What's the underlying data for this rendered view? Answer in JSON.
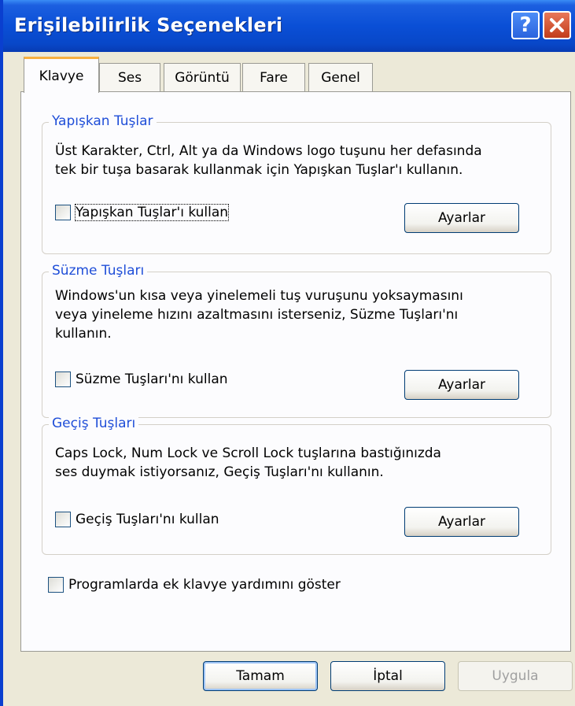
{
  "window": {
    "title": "Erişilebilirlik Seçenekleri"
  },
  "titlebar_buttons": {
    "help_label": "?",
    "help_icon": "help-icon",
    "close_icon": "close-icon"
  },
  "tabs": [
    {
      "label": "Klavye",
      "active": true
    },
    {
      "label": "Ses"
    },
    {
      "label": "Görüntü"
    },
    {
      "label": "Fare"
    },
    {
      "label": "Genel"
    }
  ],
  "groups": {
    "sticky": {
      "legend": "Yapışkan Tuşlar",
      "desc_line1": "Üst Karakter, Ctrl, Alt ya da Windows logo tuşunu her defasında",
      "desc_line2": "tek bir tuşa basarak kullanmak için Yapışkan Tuşlar'ı kullanın.",
      "checkbox_label": "Yapışkan Tuşlar'ı kullan",
      "settings_label": "Ayarlar"
    },
    "filter": {
      "legend": "Süzme Tuşları",
      "desc_line1": "Windows'un kısa veya yinelemeli tuş vuruşunu yoksaymasını",
      "desc_line2": "veya yineleme hızını azaltmasını isterseniz, Süzme Tuşları'nı",
      "desc_line3": "kullanın.",
      "checkbox_label": "Süzme Tuşları'nı kullan",
      "settings_label": "Ayarlar"
    },
    "toggle": {
      "legend": "Geçiş Tuşları",
      "desc_line1": "Caps Lock, Num Lock ve Scroll Lock tuşlarına bastığınızda",
      "desc_line2": "ses duymak istiyorsanız, Geçiş Tuşları'nı kullanın.",
      "checkbox_label": "Geçiş Tuşları'nı kullan",
      "settings_label": "Ayarlar"
    }
  },
  "extra_help": {
    "checkbox_label": "Programlarda ek klavye yardımını göster"
  },
  "footer": {
    "ok_label": "Tamam",
    "cancel_label": "İptal",
    "apply_label": "Uygula"
  },
  "colors": {
    "title_bar": "#0a4fd6",
    "group_legend": "#1f4ed8",
    "active_tab_accent": "#f8b040"
  }
}
